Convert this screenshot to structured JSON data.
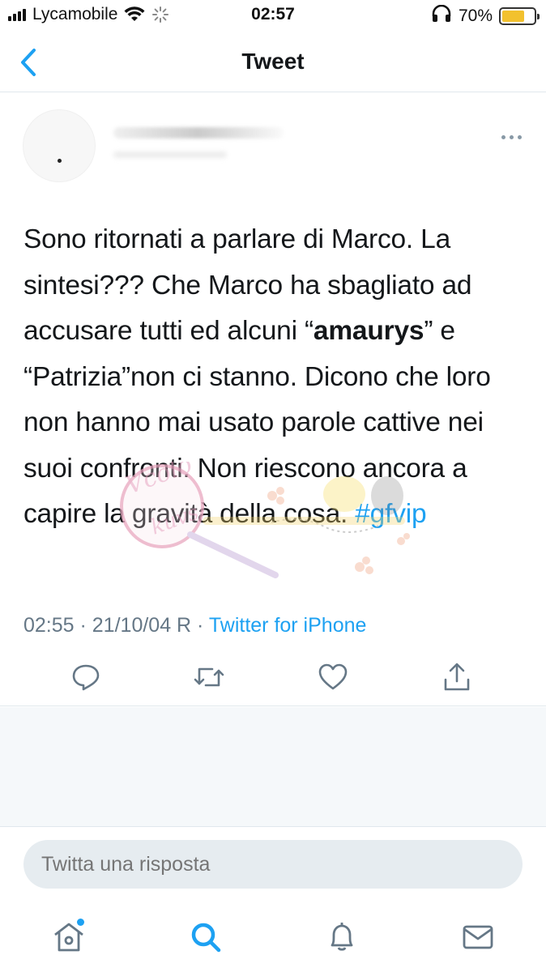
{
  "status_bar": {
    "carrier": "Lycamobile",
    "time": "02:57",
    "battery_percent": "70%",
    "battery_level": 0.7,
    "battery_color": "#f2c12e",
    "icons": [
      "signal-icon",
      "wifi-icon",
      "activity-icon",
      "headphones-icon",
      "battery-icon"
    ]
  },
  "nav": {
    "title": "Tweet",
    "back_icon": "chevron-left-icon"
  },
  "tweet": {
    "text_parts": {
      "p1": "Sono ritornati a parlare di Marco. La sintesi??? Che Marco ha sbagliato ad accusare tutti ed alcuni “",
      "bold": "amaurys",
      "p2": "” e “Patrizia”non ci stanno. Dicono che loro non hanno mai usato parole cattive nei suoi confronti. Non riescono ancora a capire la gravità della cosa. ",
      "hashtag": "#gfvip"
    },
    "meta": {
      "time": "02:55",
      "separator": " · ",
      "date": "21/10/04 R",
      "separator2": " · ",
      "source": "Twitter for iPhone"
    },
    "actions": [
      "reply-icon",
      "retweet-icon",
      "like-icon",
      "share-icon"
    ]
  },
  "reply": {
    "placeholder": "Twitta una risposta"
  },
  "tabbar": {
    "items": [
      "home-icon",
      "search-icon",
      "notifications-icon",
      "messages-icon"
    ],
    "active": "search-icon"
  },
  "colors": {
    "accent": "#1da1f2",
    "text": "#14171a",
    "muted": "#657786",
    "divider": "#e1e8ed",
    "background_grey": "#f5f8fa"
  }
}
